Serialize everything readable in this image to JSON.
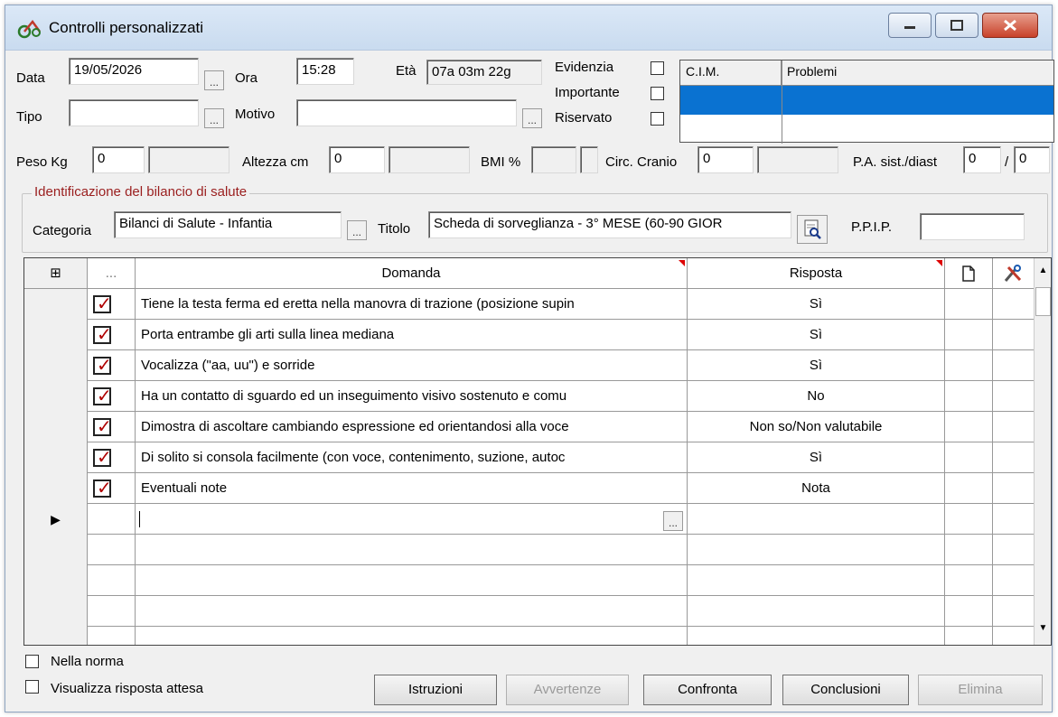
{
  "window": {
    "title": "Controlli personalizzati"
  },
  "header": {
    "data_label": "Data",
    "data_value": "19/05/2026",
    "ora_label": "Ora",
    "ora_value": "15:28",
    "eta_label": "Età",
    "eta_value": "07a 03m 22g",
    "tipo_label": "Tipo",
    "tipo_value": "",
    "motivo_label": "Motivo",
    "motivo_value": "",
    "evidenzia_label": "Evidenzia",
    "importante_label": "Importante",
    "riservato_label": "Riservato",
    "ellipsis": "..."
  },
  "problems_grid": {
    "col1": "C.I.M.",
    "col2": "Problemi"
  },
  "measures": {
    "peso_label": "Peso Kg",
    "peso_value": "0",
    "altezza_label": "Altezza cm",
    "altezza_value": "0",
    "bmi_label": "BMI %",
    "circ_label": "Circ. Cranio",
    "circ_value": "0",
    "pa_label": "P.A. sist./diast",
    "pa_sist": "0",
    "pa_sep": "/",
    "pa_diast": "0"
  },
  "identification": {
    "group_title": "Identificazione del bilancio di salute",
    "categoria_label": "Categoria",
    "categoria_value": "Bilanci di Salute - Infantia",
    "titolo_label": "Titolo",
    "titolo_value": "Scheda di sorveglianza - 3° MESE (60-90 GIOR",
    "ppip_label": "P.P.I.P.",
    "ppip_value": ""
  },
  "grid": {
    "col_expand": "⊞",
    "col_check": "...",
    "col_domanda": "Domanda",
    "col_risposta": "Risposta",
    "rows": [
      {
        "domanda": "Tiene la testa ferma ed eretta nella manovra di trazione (posizione supin",
        "risposta": "Sì"
      },
      {
        "domanda": "Porta entrambe gli arti sulla linea mediana",
        "risposta": "Sì"
      },
      {
        "domanda": "Vocalizza (\"aa, uu\") e sorride",
        "risposta": "Sì"
      },
      {
        "domanda": "Ha un contatto di sguardo ed un inseguimento visivo sostenuto e comu",
        "risposta": "No"
      },
      {
        "domanda": "Dimostra di ascoltare cambiando espressione ed orientandosi alla voce",
        "risposta": "Non so/Non valutabile"
      },
      {
        "domanda": "Di solito si consola facilmente (con voce, contenimento, suzione, autoc",
        "risposta": "Sì"
      },
      {
        "domanda": "Eventuali note",
        "risposta": "Nota"
      }
    ],
    "new_row_marker": "▶"
  },
  "footer": {
    "nella_norma": "Nella norma",
    "visualizza": "Visualizza risposta attesa",
    "btn_istruzioni": "Istruzioni",
    "btn_avvertenze": "Avvertenze",
    "btn_confronta": "Confronta",
    "btn_conclusioni": "Conclusioni",
    "btn_elimina": "Elimina"
  },
  "colors": {
    "accent_selection": "#0a72d1",
    "group_title": "#9a1e1e",
    "check_mark": "#b00000"
  }
}
